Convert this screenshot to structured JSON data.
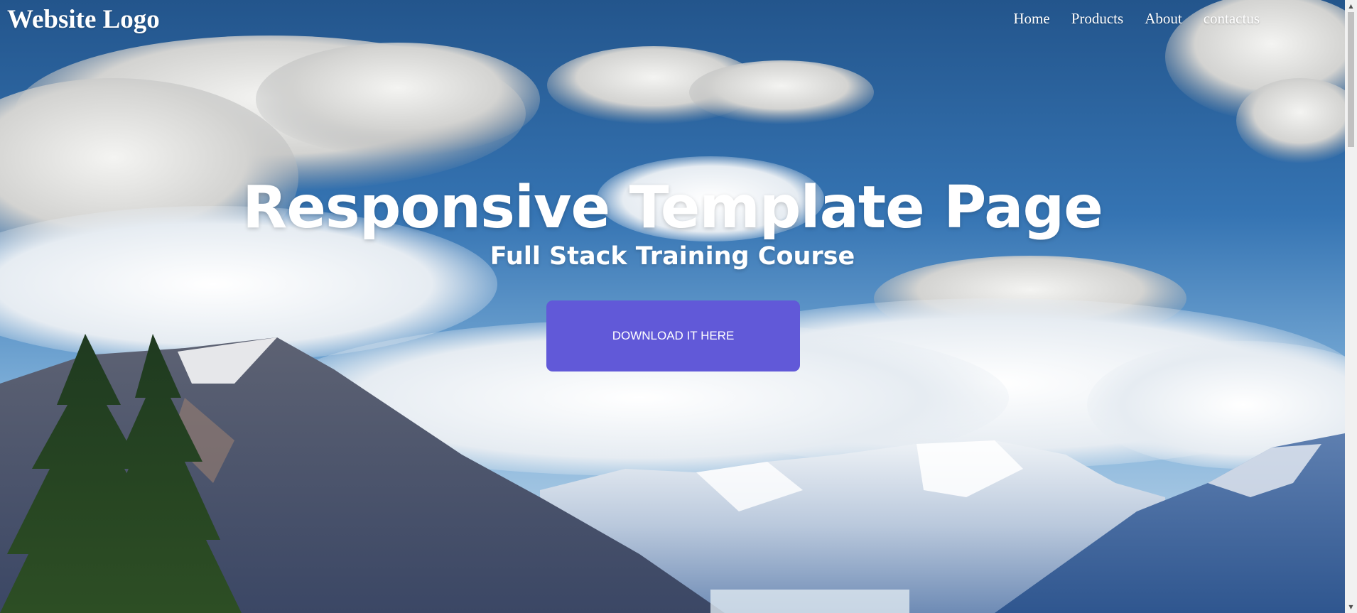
{
  "header": {
    "logo": "Website Logo",
    "nav": [
      "Home",
      "Products",
      "About",
      "contactus"
    ]
  },
  "hero": {
    "title": "Responsive Template Page",
    "subtitle": "Full Stack Training Course",
    "button_label": "DOWNLOAD IT HERE",
    "background": "mountain-landscape-photo"
  },
  "colors": {
    "button": "#6159d8",
    "text": "#ffffff",
    "sky_top": "#2e67a3",
    "sky_bottom": "#8fbde0"
  },
  "scrollbar": {
    "up_icon": "chevron-up-icon",
    "down_icon": "chevron-down-icon"
  }
}
